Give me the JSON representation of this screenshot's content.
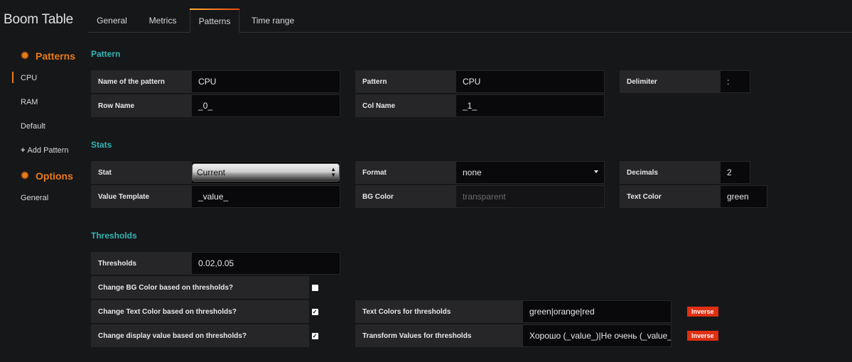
{
  "app": {
    "title": "Boom Table"
  },
  "tabs": [
    {
      "label": "General"
    },
    {
      "label": "Metrics"
    },
    {
      "label": "Patterns"
    },
    {
      "label": "Time range"
    }
  ],
  "sidebar": {
    "patterns_heading": "Patterns",
    "items": [
      "CPU",
      "RAM",
      "Default"
    ],
    "add_pattern": "Add Pattern",
    "options_heading": "Options",
    "options_items": [
      "General"
    ]
  },
  "pattern": {
    "section_title": "Pattern",
    "name_label": "Name of the pattern",
    "name_value": "CPU",
    "pattern_label": "Pattern",
    "pattern_value": "CPU",
    "delimiter_label": "Delimiter",
    "delimiter_value": ":",
    "row_name_label": "Row Name",
    "row_name_value": "_0_",
    "col_name_label": "Col Name",
    "col_name_value": "_1_"
  },
  "stats": {
    "section_title": "Stats",
    "stat_label": "Stat",
    "stat_value": "Current",
    "format_label": "Format",
    "format_value": "none",
    "decimals_label": "Decimals",
    "decimals_value": "2",
    "value_template_label": "Value Template",
    "value_template_value": "_value_",
    "bg_color_label": "BG Color",
    "bg_color_placeholder": "transparent",
    "text_color_label": "Text Color",
    "text_color_value": "green"
  },
  "thresholds": {
    "section_title": "Thresholds",
    "thresholds_label": "Thresholds",
    "thresholds_value": "0.02,0.05",
    "change_bg_label": "Change BG Color based on thresholds?",
    "change_bg_checked": false,
    "change_text_label": "Change Text Color based on thresholds?",
    "change_text_checked": true,
    "change_display_label": "Change display value based on thresholds?",
    "change_display_checked": true,
    "text_colors_label": "Text Colors for thresholds",
    "text_colors_value": "green|orange|red",
    "transform_label": "Transform Values for thresholds",
    "transform_value": "Хорошо (_value_)|Не очень (_value_)|Плохо (_value_)",
    "inverse_label": "Inverse"
  },
  "colors": {
    "accent": "#eb7b18",
    "section_title": "#33b5b5",
    "inverse_button": "#e02f12",
    "background": "#161719"
  },
  "icons": {
    "patterns_heading_icon": "gear-icon",
    "options_heading_icon": "gear-icon",
    "add_icon": "plus-icon",
    "checkbox_icon": "check-icon"
  }
}
